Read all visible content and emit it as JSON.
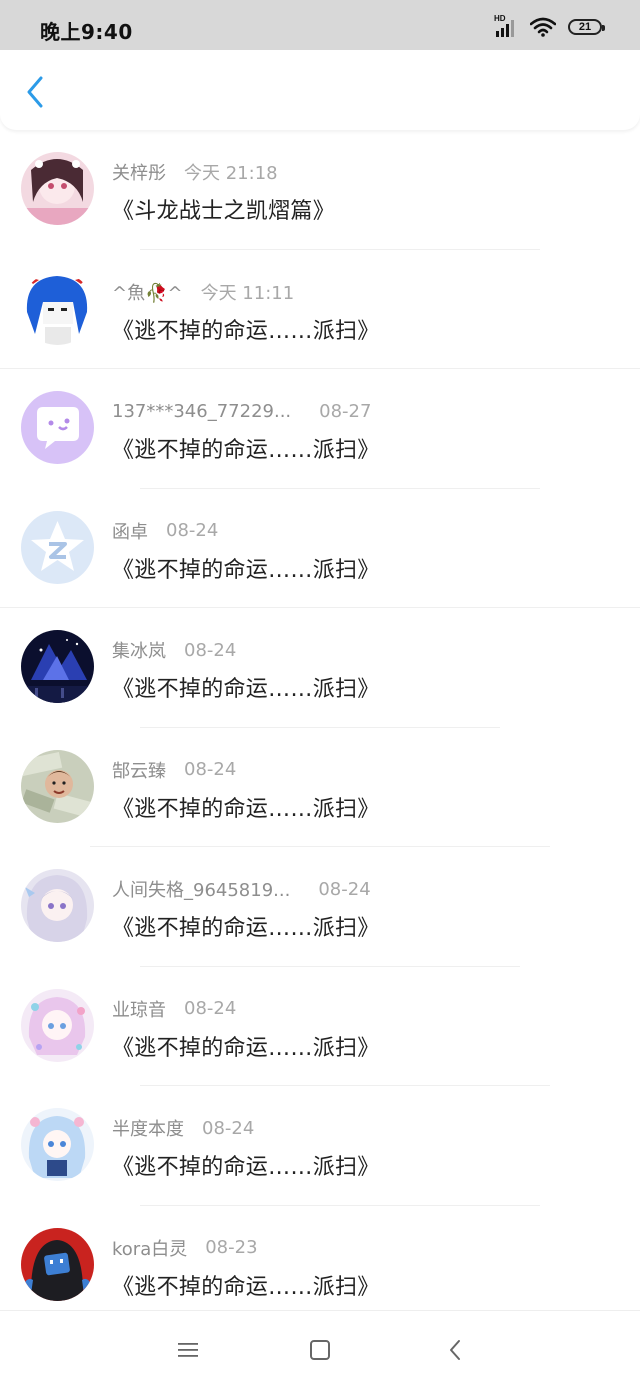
{
  "status_bar": {
    "time": "晚上9:40",
    "network_label": "HD",
    "battery": "21"
  },
  "header": {
    "back_icon": "chevron-left-icon",
    "accent_color": "#2c9be8"
  },
  "items": [
    {
      "name": "关梓彤",
      "time": "今天 21:18",
      "title": "《斗龙战士之凯熠篇》",
      "avatar": "pink-anime-girl"
    },
    {
      "name": "^魚🥀^",
      "time": "今天 11:11",
      "title": "《逃不掉的命运……派扫》",
      "avatar": "blue-hair-anime"
    },
    {
      "name": "137***346_77229...",
      "time": "08-27",
      "title": "《逃不掉的命运……派扫》",
      "avatar": "purple-chat-bubble"
    },
    {
      "name": "函卓",
      "time": "08-24",
      "title": "《逃不掉的命运……派扫》",
      "avatar": "blue-star-logo"
    },
    {
      "name": "集冰岚",
      "time": "08-24",
      "title": "《逃不掉的命运……派扫》",
      "avatar": "dark-blue-galaxy"
    },
    {
      "name": "郜云臻",
      "time": "08-24",
      "title": "《逃不掉的命运……派扫》",
      "avatar": "money-face-photo"
    },
    {
      "name": "人间失格_9645819...",
      "time": "08-24",
      "title": "《逃不掉的命运……派扫》",
      "avatar": "silver-hair-anime"
    },
    {
      "name": "业琼音",
      "time": "08-24",
      "title": "《逃不掉的命运……派扫》",
      "avatar": "pastel-anime"
    },
    {
      "name": "半度本度",
      "time": "08-24",
      "title": "《逃不掉的命运……派扫》",
      "avatar": "light-blue-anime"
    },
    {
      "name": "kora白灵",
      "time": "08-23",
      "title": "《逃不掉的命运……派扫》",
      "avatar": "dark-hood-character"
    }
  ],
  "nav_bar": {
    "menu_icon": "menu-icon",
    "home_icon": "home-square-icon",
    "back_icon": "back-triangle-icon"
  }
}
